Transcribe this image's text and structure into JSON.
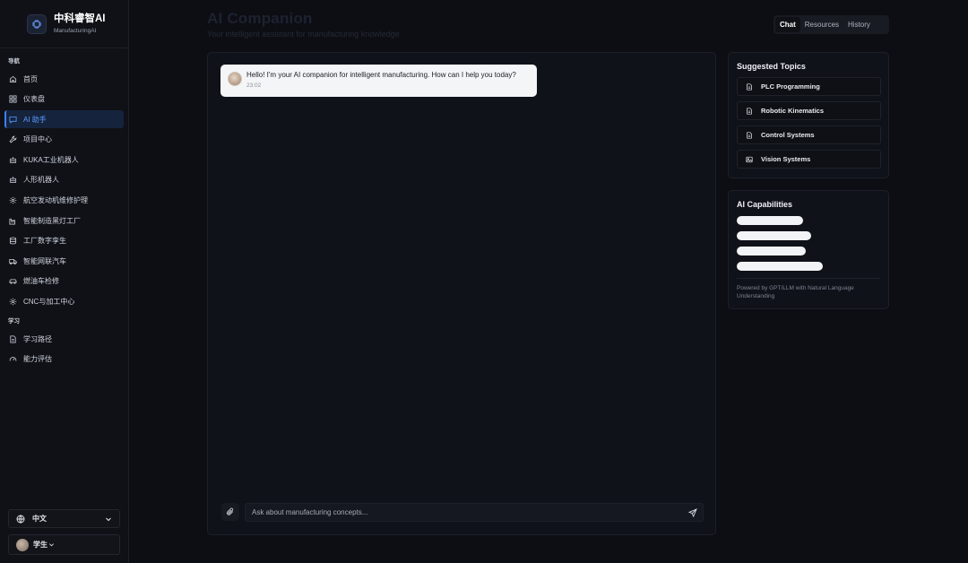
{
  "app": {
    "brand_title": "中科睿智AI",
    "brand_subtitle": "ManufacturingAI"
  },
  "sidebar": {
    "nav_label": "导航",
    "nav_items": [
      {
        "label": "首页",
        "icon": "home-icon"
      },
      {
        "label": "仪表盘",
        "icon": "grid-icon"
      },
      {
        "label": "AI 助手",
        "icon": "chat-icon",
        "active": true
      },
      {
        "label": "项目中心",
        "icon": "wrench-icon"
      },
      {
        "label": "KUKA工业机器人",
        "icon": "robot-icon"
      },
      {
        "label": "人形机器人",
        "icon": "robot-icon"
      },
      {
        "label": "航空发动机维修护理",
        "icon": "gear-icon"
      },
      {
        "label": "智能制造黑灯工厂",
        "icon": "factory-icon"
      },
      {
        "label": "工厂数字孪生",
        "icon": "database-icon"
      },
      {
        "label": "智能网联汽车",
        "icon": "truck-icon"
      },
      {
        "label": "燃油车检修",
        "icon": "car-icon"
      },
      {
        "label": "CNC与加工中心",
        "icon": "gear-icon"
      }
    ],
    "learn_label": "学习",
    "learn_items": [
      {
        "label": "学习路径",
        "icon": "document-icon"
      },
      {
        "label": "能力评估",
        "icon": "gauge-icon"
      }
    ],
    "language": "中文",
    "user_role": "学生"
  },
  "header": {
    "title": "AI Companion",
    "subtitle": "Your intelligent assistant for manufacturing knowledge",
    "tabs": [
      "Chat",
      "Resources",
      "History"
    ],
    "active_tab": "Chat"
  },
  "chat": {
    "messages": [
      {
        "text": "Hello! I'm your AI companion for intelligent manufacturing. How can I help you today?",
        "time": "23:02"
      }
    ],
    "input_placeholder": "Ask about manufacturing concepts..."
  },
  "suggested": {
    "title": "Suggested Topics",
    "topics": [
      {
        "label": "PLC Programming",
        "icon": "document-icon"
      },
      {
        "label": "Robotic Kinematics",
        "icon": "document-icon"
      },
      {
        "label": "Control Systems",
        "icon": "document-icon"
      },
      {
        "label": "Vision Systems",
        "icon": "image-icon"
      }
    ]
  },
  "capabilities": {
    "title": "AI Capabilities",
    "note": "Powered by GPT/LLM with Natural Language Understanding"
  },
  "colors": {
    "accent": "#3b82f6",
    "background": "#0c0e14",
    "panel": "#10121a"
  }
}
